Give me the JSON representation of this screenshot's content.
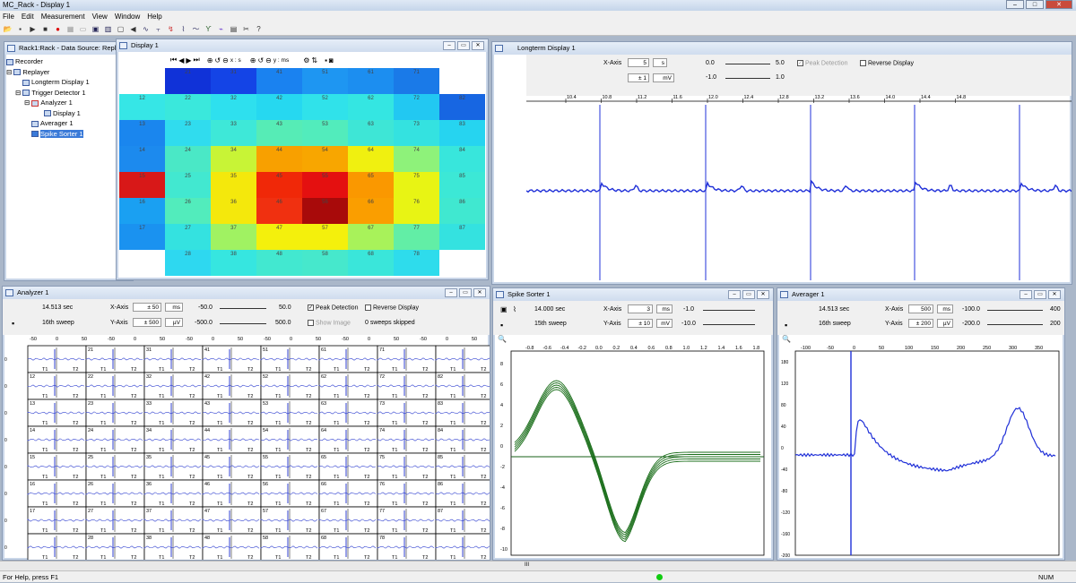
{
  "app": {
    "title": "MC_Rack - Display 1",
    "menu": [
      "File",
      "Edit",
      "Measurement",
      "View",
      "Window",
      "Help"
    ],
    "status_help": "For Help, press F1",
    "status_num": "NUM",
    "scroll_mark": "III"
  },
  "rack": {
    "title": "Rack1:Rack - Data Source: Replayer",
    "tree": [
      {
        "label": "Recorder",
        "indent": 0
      },
      {
        "label": "Replayer",
        "indent": 0
      },
      {
        "label": "Longterm Display 1",
        "indent": 1
      },
      {
        "label": "Trigger Detector 1",
        "indent": 1
      },
      {
        "label": "Analyzer 1",
        "indent": 2
      },
      {
        "label": "Display 1",
        "indent": 3
      },
      {
        "label": "Averager 1",
        "indent": 1
      },
      {
        "label": "Spike Sorter 1",
        "indent": 1
      }
    ]
  },
  "display1": {
    "title": "Display 1",
    "x_label": "x : s",
    "y_label": "y : ms",
    "rows": [
      [
        {
          "id": "",
          "c": "#ffffff"
        },
        {
          "id": "21",
          "c": "#1032d8"
        },
        {
          "id": "31",
          "c": "#1444e6"
        },
        {
          "id": "41",
          "c": "#1a82f0"
        },
        {
          "id": "51",
          "c": "#1e96f2"
        },
        {
          "id": "61",
          "c": "#1c8ef0"
        },
        {
          "id": "71",
          "c": "#1a7ae8"
        },
        {
          "id": "",
          "c": "#ffffff"
        }
      ],
      [
        {
          "id": "12",
          "c": "#36e6e6"
        },
        {
          "id": "22",
          "c": "#3ae8dc"
        },
        {
          "id": "32",
          "c": "#2ee0ee"
        },
        {
          "id": "42",
          "c": "#26d8f0"
        },
        {
          "id": "52",
          "c": "#30e2ea"
        },
        {
          "id": "62",
          "c": "#34e6e2"
        },
        {
          "id": "72",
          "c": "#22c8f2"
        },
        {
          "id": "82",
          "c": "#1766e2"
        }
      ],
      [
        {
          "id": "13",
          "c": "#1a86ee"
        },
        {
          "id": "23",
          "c": "#30dcee"
        },
        {
          "id": "33",
          "c": "#3ee8d8"
        },
        {
          "id": "43",
          "c": "#56ecb6"
        },
        {
          "id": "53",
          "c": "#52ecbc"
        },
        {
          "id": "63",
          "c": "#3ee6d6"
        },
        {
          "id": "73",
          "c": "#34e2e0"
        },
        {
          "id": "83",
          "c": "#26d4f0"
        }
      ],
      [
        {
          "id": "14",
          "c": "#1c8aee"
        },
        {
          "id": "24",
          "c": "#4ae8c6"
        },
        {
          "id": "34",
          "c": "#c8f436"
        },
        {
          "id": "44",
          "c": "#f8a000"
        },
        {
          "id": "54",
          "c": "#f8a600"
        },
        {
          "id": "64",
          "c": "#f0f010"
        },
        {
          "id": "74",
          "c": "#8ef27a"
        },
        {
          "id": "84",
          "c": "#38e6dc"
        }
      ],
      [
        {
          "id": "15",
          "c": "#d81818"
        },
        {
          "id": "25",
          "c": "#42e8d0"
        },
        {
          "id": "35",
          "c": "#f4e80c"
        },
        {
          "id": "45",
          "c": "#f02808"
        },
        {
          "id": "55",
          "c": "#e41010"
        },
        {
          "id": "65",
          "c": "#fa9800"
        },
        {
          "id": "75",
          "c": "#e8f414"
        },
        {
          "id": "85",
          "c": "#3ce8d6"
        }
      ],
      [
        {
          "id": "16",
          "c": "#1aa0f2"
        },
        {
          "id": "26",
          "c": "#52ecbc"
        },
        {
          "id": "36",
          "c": "#f4e80c"
        },
        {
          "id": "46",
          "c": "#f03010"
        },
        {
          "id": "56",
          "c": "#a80a0a"
        },
        {
          "id": "66",
          "c": "#fa9e00"
        },
        {
          "id": "76",
          "c": "#e8f414"
        },
        {
          "id": "86",
          "c": "#40e8d0"
        }
      ],
      [
        {
          "id": "17",
          "c": "#1a92f0"
        },
        {
          "id": "27",
          "c": "#34e2e0"
        },
        {
          "id": "37",
          "c": "#a0f262"
        },
        {
          "id": "47",
          "c": "#f4f00c"
        },
        {
          "id": "57",
          "c": "#f4f00c"
        },
        {
          "id": "67",
          "c": "#a8f25a"
        },
        {
          "id": "77",
          "c": "#62eea6"
        },
        {
          "id": "87",
          "c": "#34e2e0"
        }
      ],
      [
        {
          "id": "",
          "c": "#ffffff"
        },
        {
          "id": "28",
          "c": "#2ed8f0"
        },
        {
          "id": "38",
          "c": "#36e6e0"
        },
        {
          "id": "48",
          "c": "#42e8d0"
        },
        {
          "id": "58",
          "c": "#46e8cc"
        },
        {
          "id": "68",
          "c": "#3ae6da"
        },
        {
          "id": "78",
          "c": "#2edcec"
        },
        {
          "id": "",
          "c": "#ffffff"
        }
      ]
    ]
  },
  "longterm": {
    "title": "Longterm Display 1",
    "xaxis_label": "X-Axis",
    "xaxis_value": "5",
    "xaxis_unit": "s",
    "yaxis_value": "± 1",
    "yaxis_unit": "mV",
    "range1_start": "0.0",
    "range1_end": "5.0",
    "range2_start": "-1.0",
    "range2_end": "1.0",
    "peak_detection": "Peak Detection",
    "reverse_display": "Reverse Display",
    "ticks": [
      "10.4",
      "10.8",
      "11.2",
      "11.6",
      "12.0",
      "12.4",
      "12.8",
      "13.2",
      "13.6",
      "14.0",
      "14.4",
      "14.8"
    ]
  },
  "analyzer": {
    "title": "Analyzer 1",
    "time": "14.513 sec",
    "sweep": "16th sweep",
    "xaxis_label": "X-Axis",
    "xaxis_value": "± 50",
    "xaxis_unit": "ms",
    "yaxis_label": "Y-Axis",
    "yaxis_value": "± 500",
    "yaxis_unit": "µV",
    "x_start": "-50.0",
    "x_end": "50.0",
    "y_start": "-500.0",
    "y_end": "500.0",
    "peak_detection": "Peak Detection",
    "reverse_display": "Reverse Display",
    "show_image": "Show Image",
    "skipped": "0 sweeps skipped",
    "t1": "T1",
    "t2": "T2",
    "ids": [
      [
        "",
        "21",
        "31",
        "41",
        "51",
        "61",
        "71",
        ""
      ],
      [
        "12",
        "22",
        "32",
        "42",
        "52",
        "62",
        "72",
        "82"
      ],
      [
        "13",
        "23",
        "33",
        "43",
        "53",
        "63",
        "73",
        "83"
      ],
      [
        "14",
        "24",
        "34",
        "44",
        "54",
        "64",
        "74",
        "84"
      ],
      [
        "15",
        "25",
        "35",
        "45",
        "55",
        "65",
        "75",
        "85"
      ],
      [
        "16",
        "26",
        "36",
        "46",
        "56",
        "66",
        "76",
        "86"
      ],
      [
        "17",
        "27",
        "37",
        "47",
        "57",
        "67",
        "77",
        "87"
      ],
      [
        "",
        "28",
        "38",
        "48",
        "58",
        "68",
        "78",
        ""
      ]
    ]
  },
  "spike": {
    "title": "Spike Sorter 1",
    "time": "14.000 sec",
    "sweep": "15th sweep",
    "xaxis_label": "X-Axis",
    "xaxis_value": "3",
    "xaxis_unit": "ms",
    "yaxis_label": "Y-Axis",
    "yaxis_value": "± 10",
    "yaxis_unit": "mV",
    "x_start": "-1.0",
    "y_start": "-10.0",
    "xticks": [
      "-0.8",
      "-0.6",
      "-0.4",
      "-0.2",
      "0.0",
      "0.2",
      "0.4",
      "0.6",
      "0.8",
      "1.0",
      "1.2",
      "1.4",
      "1.6",
      "1.8"
    ],
    "yticks": [
      "8",
      "6",
      "4",
      "2",
      "0",
      "-2",
      "-4",
      "-6",
      "-8",
      "-10"
    ]
  },
  "averager": {
    "title": "Averager 1",
    "time": "14.513 sec",
    "sweep": "16th sweep",
    "xaxis_label": "X-Axis",
    "xaxis_value": "500",
    "xaxis_unit": "ms",
    "yaxis_label": "Y-Axis",
    "yaxis_value": "± 200",
    "yaxis_unit": "µV",
    "x_start": "-100.0",
    "x_end": "400",
    "y_start": "-200.0",
    "y_end": "200",
    "xticks": [
      "-100",
      "-50",
      "0",
      "50",
      "100",
      "150",
      "200",
      "250",
      "300",
      "350"
    ],
    "yticks": [
      "180",
      "120",
      "80",
      "40",
      "0",
      "-40",
      "-80",
      "-120",
      "-160",
      "-200"
    ]
  }
}
